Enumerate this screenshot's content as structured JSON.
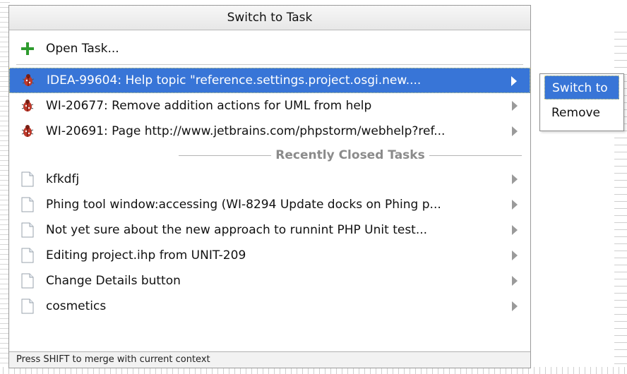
{
  "popup": {
    "title": "Switch to Task",
    "open_task": {
      "label": "Open Task...",
      "icon": "plus-icon"
    },
    "active_tasks": [
      {
        "label": "IDEA-99604: Help topic \"reference.settings.project.osgi.new....",
        "icon": "bug-icon",
        "selected": true
      },
      {
        "label": "WI-20677: Remove addition actions for UML from help",
        "icon": "bug-icon",
        "selected": false
      },
      {
        "label": "WI-20691: Page http://www.jetbrains.com/phpstorm/webhelp?ref...",
        "icon": "bug-icon",
        "selected": false
      }
    ],
    "recently_closed_title": "Recently Closed Tasks",
    "closed_tasks": [
      {
        "label": "kfkdfj",
        "icon": "document-icon"
      },
      {
        "label": "Phing tool window:accessing (WI-8294 Update docks on Phing p...",
        "icon": "document-icon"
      },
      {
        "label": "Not yet sure about the new approach to runnint PHP Unit test...",
        "icon": "document-icon"
      },
      {
        "label": "Editing project.ihp from UNIT-209",
        "icon": "document-icon"
      },
      {
        "label": "Change Details button",
        "icon": "document-icon"
      },
      {
        "label": "cosmetics",
        "icon": "document-icon"
      }
    ],
    "footer": "Press SHIFT to merge with current context"
  },
  "submenu": {
    "items": [
      {
        "label": "Switch to",
        "active": true
      },
      {
        "label": "Remove",
        "active": false
      }
    ]
  },
  "colors": {
    "selection": "#3875d7",
    "plus": "#2e9b2e",
    "bug": "#c0392b",
    "separator_text": "#8b8b8b"
  }
}
